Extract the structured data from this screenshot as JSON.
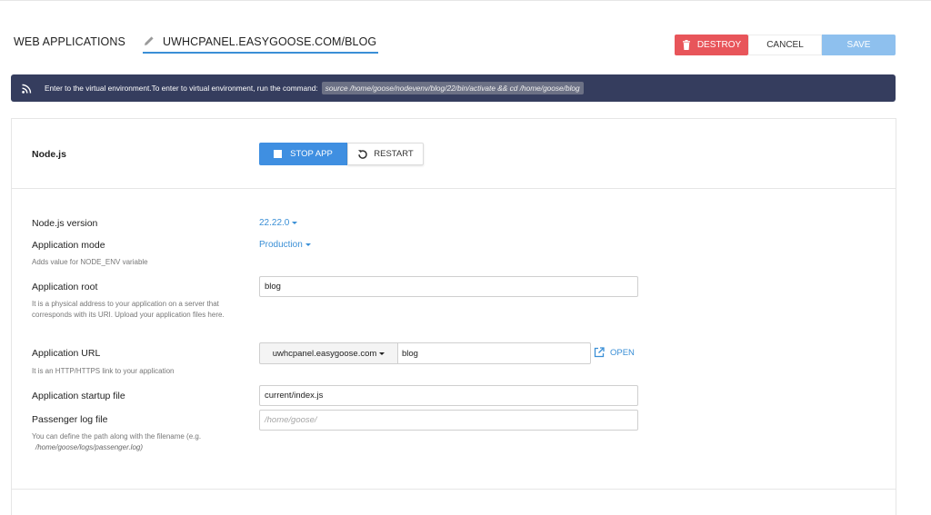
{
  "header": {
    "breadcrumb": "WEB APPLICATIONS",
    "active_tab": "UWHCPANEL.EASYGOOSE.COM/BLOG",
    "destroy_label": "DESTROY",
    "cancel_label": "CANCEL",
    "save_label": "SAVE"
  },
  "banner": {
    "text": "Enter to the virtual environment.To enter to virtual environment, run the command:",
    "command": "source /home/goose/nodevenv/blog/22/bin/activate && cd /home/goose/blog"
  },
  "node": {
    "title": "Node.js",
    "stop_label": "STOP APP",
    "restart_label": "RESTART"
  },
  "form": {
    "version_label": "Node.js version",
    "version_value": "22.22.0",
    "mode_label": "Application mode",
    "mode_value": "Production",
    "mode_help": "Adds value for NODE_ENV variable",
    "root_label": "Application root",
    "root_value": "blog",
    "root_help": "It is a physical address to your application on a server that corresponds with its URI. Upload your application files here.",
    "url_label": "Application URL",
    "url_help": "It is an HTTP/HTTPS link to your application",
    "url_domain": "uwhcpanel.easygoose.com",
    "url_path": "blog",
    "open_label": "OPEN",
    "startup_label": "Application startup file",
    "startup_value": "current/index.js",
    "log_label": "Passenger log file",
    "log_placeholder": "/home/goose/",
    "log_help_prefix": "You can define the path along with the filename (e.g.",
    "log_help_example": "/home/goose/logs/passenger.log)"
  },
  "colors": {
    "accent": "#3a8fd6",
    "destroy": "#e8555a",
    "save_disabled": "#8ec0ee",
    "banner_bg": "#353d5e",
    "stop_bg": "#3f8fe1"
  },
  "icons": {
    "tab": "pencil-icon",
    "destroy": "trash-icon",
    "banner": "rss-icon",
    "stop": "stop-square-icon",
    "restart": "restart-icon",
    "open": "external-link-icon"
  }
}
